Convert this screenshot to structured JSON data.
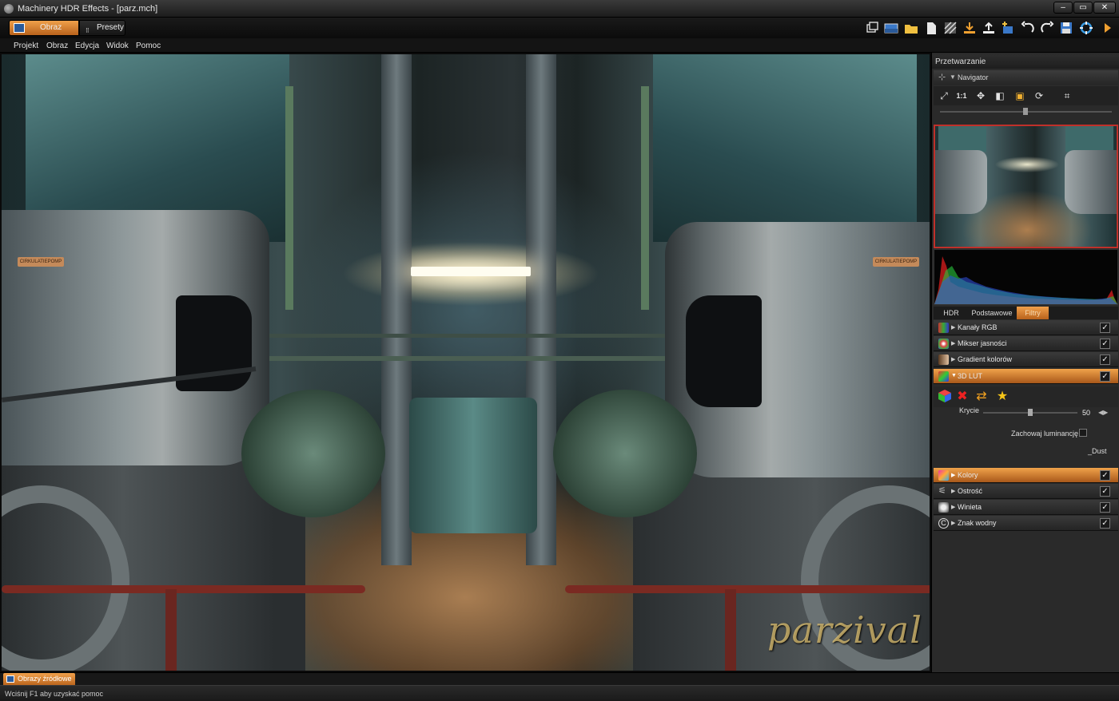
{
  "window": {
    "title": "Machinery HDR Effects - [parz.mch]",
    "min_glyph": "–",
    "max_glyph": "▭",
    "close_glyph": "✕"
  },
  "toolbar": {
    "tabs": [
      {
        "label": "Obraz",
        "active": true
      },
      {
        "label": "Presety",
        "active": false
      }
    ],
    "icons": [
      "windows-icon",
      "image-icon",
      "folder-open-icon",
      "new-file-icon",
      "batch-icon",
      "download-icon",
      "upload-icon",
      "add-icon",
      "undo-icon",
      "redo-icon",
      "save-icon",
      "settings-icon",
      "play-icon"
    ]
  },
  "menu": [
    "Projekt",
    "Obraz",
    "Edycja",
    "Widok",
    "Pomoc"
  ],
  "canvas": {
    "plate_left": "CIRKULATIEPOMP",
    "plate_right": "CIRKULATIEPOMP",
    "watermark": "parzival"
  },
  "panel": {
    "title": "Przetwarzanie",
    "navigator": {
      "title": "Navigator",
      "tools": {
        "fit": "⤢",
        "zoom_1to1": "1:1",
        "pan": "✥",
        "split": "◧",
        "frame": "▣",
        "refresh": "⟳",
        "crop": "⌗"
      },
      "zoom_level": 0.53
    },
    "filter_tabs": [
      {
        "label": "HDR",
        "active": false
      },
      {
        "label": "Podstawowe",
        "active": false
      },
      {
        "label": "Filtry",
        "active": true
      }
    ],
    "filters_top": [
      {
        "label": "Kanały RGB",
        "checked": true,
        "active": false,
        "color": "#cc3333"
      },
      {
        "label": "Mikser jasności",
        "checked": true,
        "active": false,
        "color": "#44aa44"
      },
      {
        "label": "Gradient kolorów",
        "checked": true,
        "active": false,
        "color": "#c8a080"
      },
      {
        "label": "3D LUT",
        "checked": true,
        "active": true,
        "color": "#cc4499"
      }
    ],
    "lut": {
      "strength_label": "Krycie",
      "strength_value": "50",
      "preserve_label": "Zachowaj luminancję",
      "preserve_checked": false,
      "lut_name": "_Dust",
      "spin_glyph": "◀▶"
    },
    "filters_bottom": [
      {
        "label": "Kolory",
        "checked": true,
        "active": true,
        "color": "#dd44aa"
      },
      {
        "label": "Ostrość",
        "checked": true,
        "active": false,
        "color": "#888888"
      },
      {
        "label": "Winieta",
        "checked": true,
        "active": false,
        "color": "#bbbbbb"
      },
      {
        "label": "Znak wodny",
        "checked": true,
        "active": false,
        "color": "#dddddd"
      }
    ],
    "check_glyph": "✓",
    "arrow_glyph": "▶"
  },
  "bottom": {
    "source_tab": "Obrazy źródłowe",
    "status": "Wciśnij F1 aby uzyskać pomoc"
  },
  "colors": {
    "accent": "#e0882e",
    "panel_bg": "#2a2a2a",
    "nav_border": "#c0302a"
  }
}
